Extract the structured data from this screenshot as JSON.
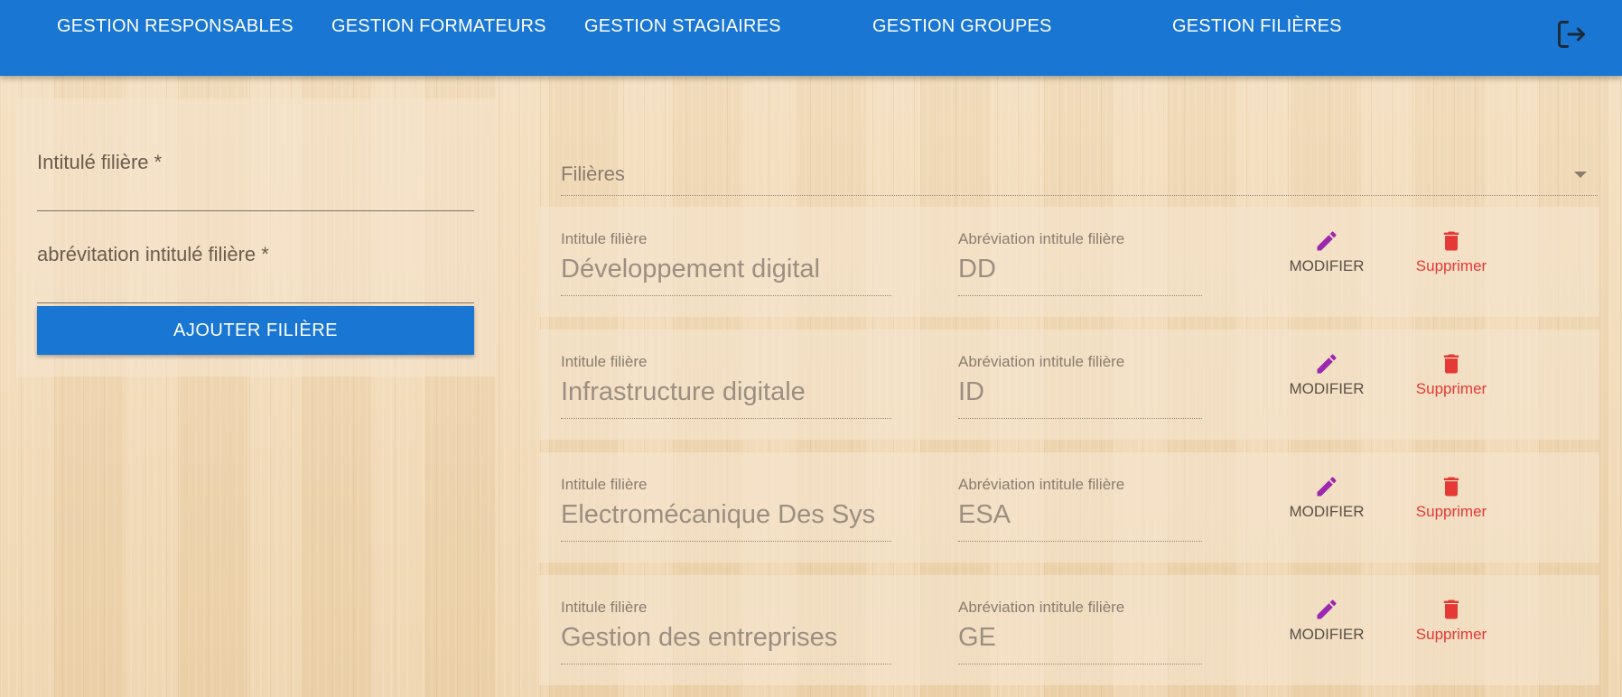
{
  "nav": {
    "items": [
      {
        "label": "GESTION RESPONSABLES"
      },
      {
        "label": "GESTION FORMATEURS"
      },
      {
        "label": "GESTION STAGIAIRES"
      },
      {
        "label": "GESTION GROUPES"
      },
      {
        "label": "GESTION FILIÈRES"
      }
    ],
    "logout_icon": "logout-icon"
  },
  "form": {
    "intitule_label": "Intitulé filière *",
    "intitule_value": "",
    "abreviation_label": "abrévitation intitulé filière *",
    "abreviation_value": "",
    "submit_label": "AJOUTER FILIÈRE"
  },
  "filter": {
    "label": "Filières"
  },
  "table": {
    "col_intitule": "Intitule filière",
    "col_abreviation": "Abréviation intitule filière",
    "modify_label": "MODIFIER",
    "delete_label": "Supprimer",
    "rows": [
      {
        "intitule": "Développement digital",
        "abreviation": "DD"
      },
      {
        "intitule": "Infrastructure digitale",
        "abreviation": "ID"
      },
      {
        "intitule": "Electromécanique Des Sys",
        "abreviation": "ESA"
      },
      {
        "intitule": "Gestion des entreprises",
        "abreviation": "GE"
      }
    ]
  },
  "colors": {
    "primary": "#1976d2",
    "modify": "#9c27b0",
    "delete": "#e53935"
  }
}
